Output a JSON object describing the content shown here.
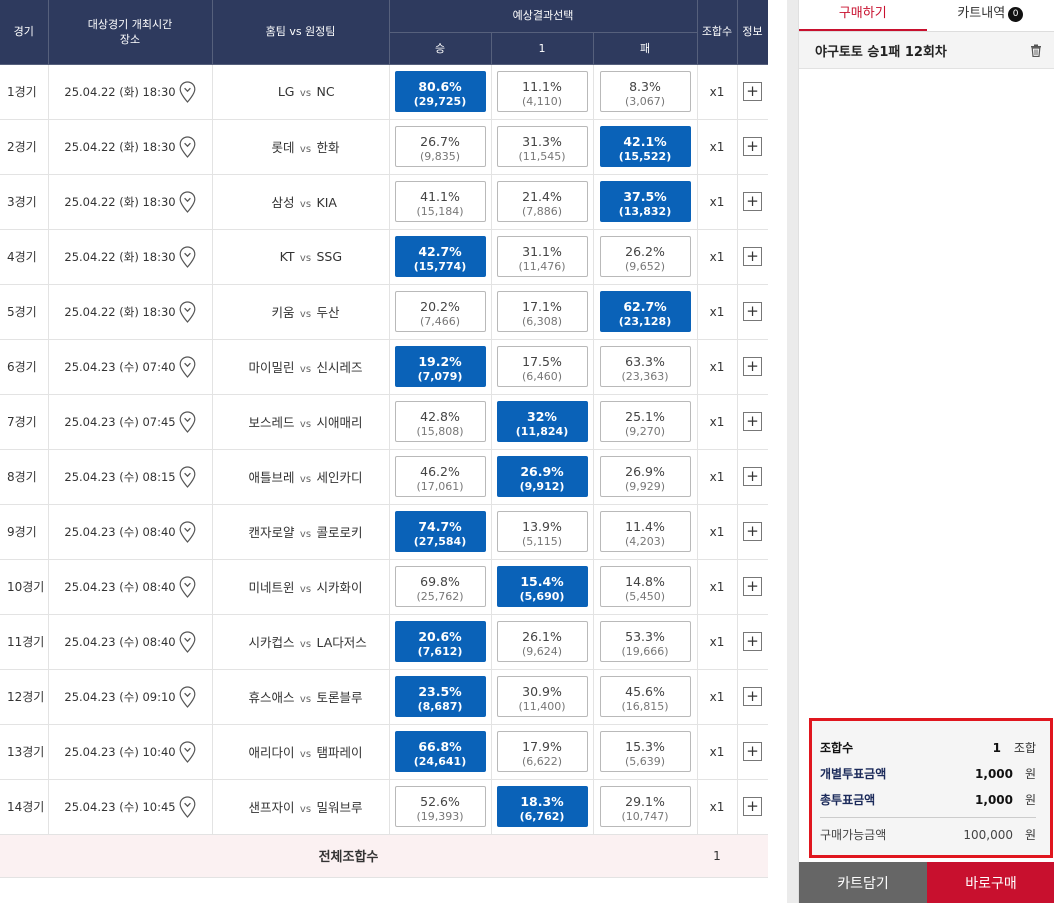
{
  "table": {
    "headers": {
      "game": "경기",
      "time_line1": "대상경기 개최시간",
      "time_line2": "장소",
      "teams": "홈팀 vs 원정팀",
      "prediction": "예상결과선택",
      "win": "승",
      "draw": "1",
      "loss": "패",
      "combo": "조합수",
      "info": "정보"
    },
    "vs_label": "vs",
    "rows": [
      {
        "no": "1경기",
        "time": "25.04.22 (화) 18:30",
        "home": "LG",
        "away": "NC",
        "options": [
          {
            "pct": "80.6%",
            "cnt": "(29,725)"
          },
          {
            "pct": "11.1%",
            "cnt": "(4,110)"
          },
          {
            "pct": "8.3%",
            "cnt": "(3,067)"
          }
        ],
        "selected": 0,
        "mult": "x1"
      },
      {
        "no": "2경기",
        "time": "25.04.22 (화) 18:30",
        "home": "롯데",
        "away": "한화",
        "options": [
          {
            "pct": "26.7%",
            "cnt": "(9,835)"
          },
          {
            "pct": "31.3%",
            "cnt": "(11,545)"
          },
          {
            "pct": "42.1%",
            "cnt": "(15,522)"
          }
        ],
        "selected": 2,
        "mult": "x1"
      },
      {
        "no": "3경기",
        "time": "25.04.22 (화) 18:30",
        "home": "삼성",
        "away": "KIA",
        "options": [
          {
            "pct": "41.1%",
            "cnt": "(15,184)"
          },
          {
            "pct": "21.4%",
            "cnt": "(7,886)"
          },
          {
            "pct": "37.5%",
            "cnt": "(13,832)"
          }
        ],
        "selected": 2,
        "mult": "x1"
      },
      {
        "no": "4경기",
        "time": "25.04.22 (화) 18:30",
        "home": "KT",
        "away": "SSG",
        "options": [
          {
            "pct": "42.7%",
            "cnt": "(15,774)"
          },
          {
            "pct": "31.1%",
            "cnt": "(11,476)"
          },
          {
            "pct": "26.2%",
            "cnt": "(9,652)"
          }
        ],
        "selected": 0,
        "mult": "x1"
      },
      {
        "no": "5경기",
        "time": "25.04.22 (화) 18:30",
        "home": "키움",
        "away": "두산",
        "options": [
          {
            "pct": "20.2%",
            "cnt": "(7,466)"
          },
          {
            "pct": "17.1%",
            "cnt": "(6,308)"
          },
          {
            "pct": "62.7%",
            "cnt": "(23,128)"
          }
        ],
        "selected": 2,
        "mult": "x1"
      },
      {
        "no": "6경기",
        "time": "25.04.23 (수) 07:40",
        "home": "마이밀린",
        "away": "신시레즈",
        "options": [
          {
            "pct": "19.2%",
            "cnt": "(7,079)"
          },
          {
            "pct": "17.5%",
            "cnt": "(6,460)"
          },
          {
            "pct": "63.3%",
            "cnt": "(23,363)"
          }
        ],
        "selected": 0,
        "mult": "x1"
      },
      {
        "no": "7경기",
        "time": "25.04.23 (수) 07:45",
        "home": "보스레드",
        "away": "시애매리",
        "options": [
          {
            "pct": "42.8%",
            "cnt": "(15,808)"
          },
          {
            "pct": "32%",
            "cnt": "(11,824)"
          },
          {
            "pct": "25.1%",
            "cnt": "(9,270)"
          }
        ],
        "selected": 1,
        "mult": "x1"
      },
      {
        "no": "8경기",
        "time": "25.04.23 (수) 08:15",
        "home": "애틀브레",
        "away": "세인카디",
        "options": [
          {
            "pct": "46.2%",
            "cnt": "(17,061)"
          },
          {
            "pct": "26.9%",
            "cnt": "(9,912)"
          },
          {
            "pct": "26.9%",
            "cnt": "(9,929)"
          }
        ],
        "selected": 1,
        "mult": "x1"
      },
      {
        "no": "9경기",
        "time": "25.04.23 (수) 08:40",
        "home": "캔자로얄",
        "away": "콜로로키",
        "options": [
          {
            "pct": "74.7%",
            "cnt": "(27,584)"
          },
          {
            "pct": "13.9%",
            "cnt": "(5,115)"
          },
          {
            "pct": "11.4%",
            "cnt": "(4,203)"
          }
        ],
        "selected": 0,
        "mult": "x1"
      },
      {
        "no": "10경기",
        "time": "25.04.23 (수) 08:40",
        "home": "미네트윈",
        "away": "시카화이",
        "options": [
          {
            "pct": "69.8%",
            "cnt": "(25,762)"
          },
          {
            "pct": "15.4%",
            "cnt": "(5,690)"
          },
          {
            "pct": "14.8%",
            "cnt": "(5,450)"
          }
        ],
        "selected": 1,
        "mult": "x1"
      },
      {
        "no": "11경기",
        "time": "25.04.23 (수) 08:40",
        "home": "시카컵스",
        "away": "LA다저스",
        "options": [
          {
            "pct": "20.6%",
            "cnt": "(7,612)"
          },
          {
            "pct": "26.1%",
            "cnt": "(9,624)"
          },
          {
            "pct": "53.3%",
            "cnt": "(19,666)"
          }
        ],
        "selected": 0,
        "mult": "x1"
      },
      {
        "no": "12경기",
        "time": "25.04.23 (수) 09:10",
        "home": "휴스애스",
        "away": "토론블루",
        "options": [
          {
            "pct": "23.5%",
            "cnt": "(8,687)"
          },
          {
            "pct": "30.9%",
            "cnt": "(11,400)"
          },
          {
            "pct": "45.6%",
            "cnt": "(16,815)"
          }
        ],
        "selected": 0,
        "mult": "x1"
      },
      {
        "no": "13경기",
        "time": "25.04.23 (수) 10:40",
        "home": "애리다이",
        "away": "탬파레이",
        "options": [
          {
            "pct": "66.8%",
            "cnt": "(24,641)"
          },
          {
            "pct": "17.9%",
            "cnt": "(6,622)"
          },
          {
            "pct": "15.3%",
            "cnt": "(5,639)"
          }
        ],
        "selected": 0,
        "mult": "x1"
      },
      {
        "no": "14경기",
        "time": "25.04.23 (수) 10:45",
        "home": "샌프자이",
        "away": "밀워브루",
        "options": [
          {
            "pct": "52.6%",
            "cnt": "(19,393)"
          },
          {
            "pct": "18.3%",
            "cnt": "(6,762)"
          },
          {
            "pct": "29.1%",
            "cnt": "(10,747)"
          }
        ],
        "selected": 1,
        "mult": "x1"
      }
    ],
    "footer": {
      "label": "전체조합수",
      "value": "1"
    }
  },
  "panel": {
    "tabs": [
      {
        "label": "구매하기",
        "active": true
      },
      {
        "label": "카트내역",
        "badge": "0"
      }
    ],
    "slip_title": "야구토토 승1패 12회차",
    "summary": {
      "combo_label": "조합수",
      "combo_value": "1",
      "combo_unit": "조합",
      "per_label": "개별투표금액",
      "per_value": "1,000",
      "per_unit": "원",
      "total_label": "총투표금액",
      "total_value": "1,000",
      "total_unit": "원",
      "avail_label": "구매가능금액",
      "avail_value": "100,000",
      "avail_unit": "원"
    },
    "buttons": {
      "cart": "카트담기",
      "buy": "바로구매"
    }
  },
  "colors": {
    "header_navy": "#2e3a5e",
    "selected_blue": "#0a62b8",
    "accent_red": "#c8102e",
    "highlight_box": "#e0161e"
  },
  "icons": {
    "location": "map-pin-icon",
    "detail": "plus-icon",
    "delete": "trash-icon"
  }
}
